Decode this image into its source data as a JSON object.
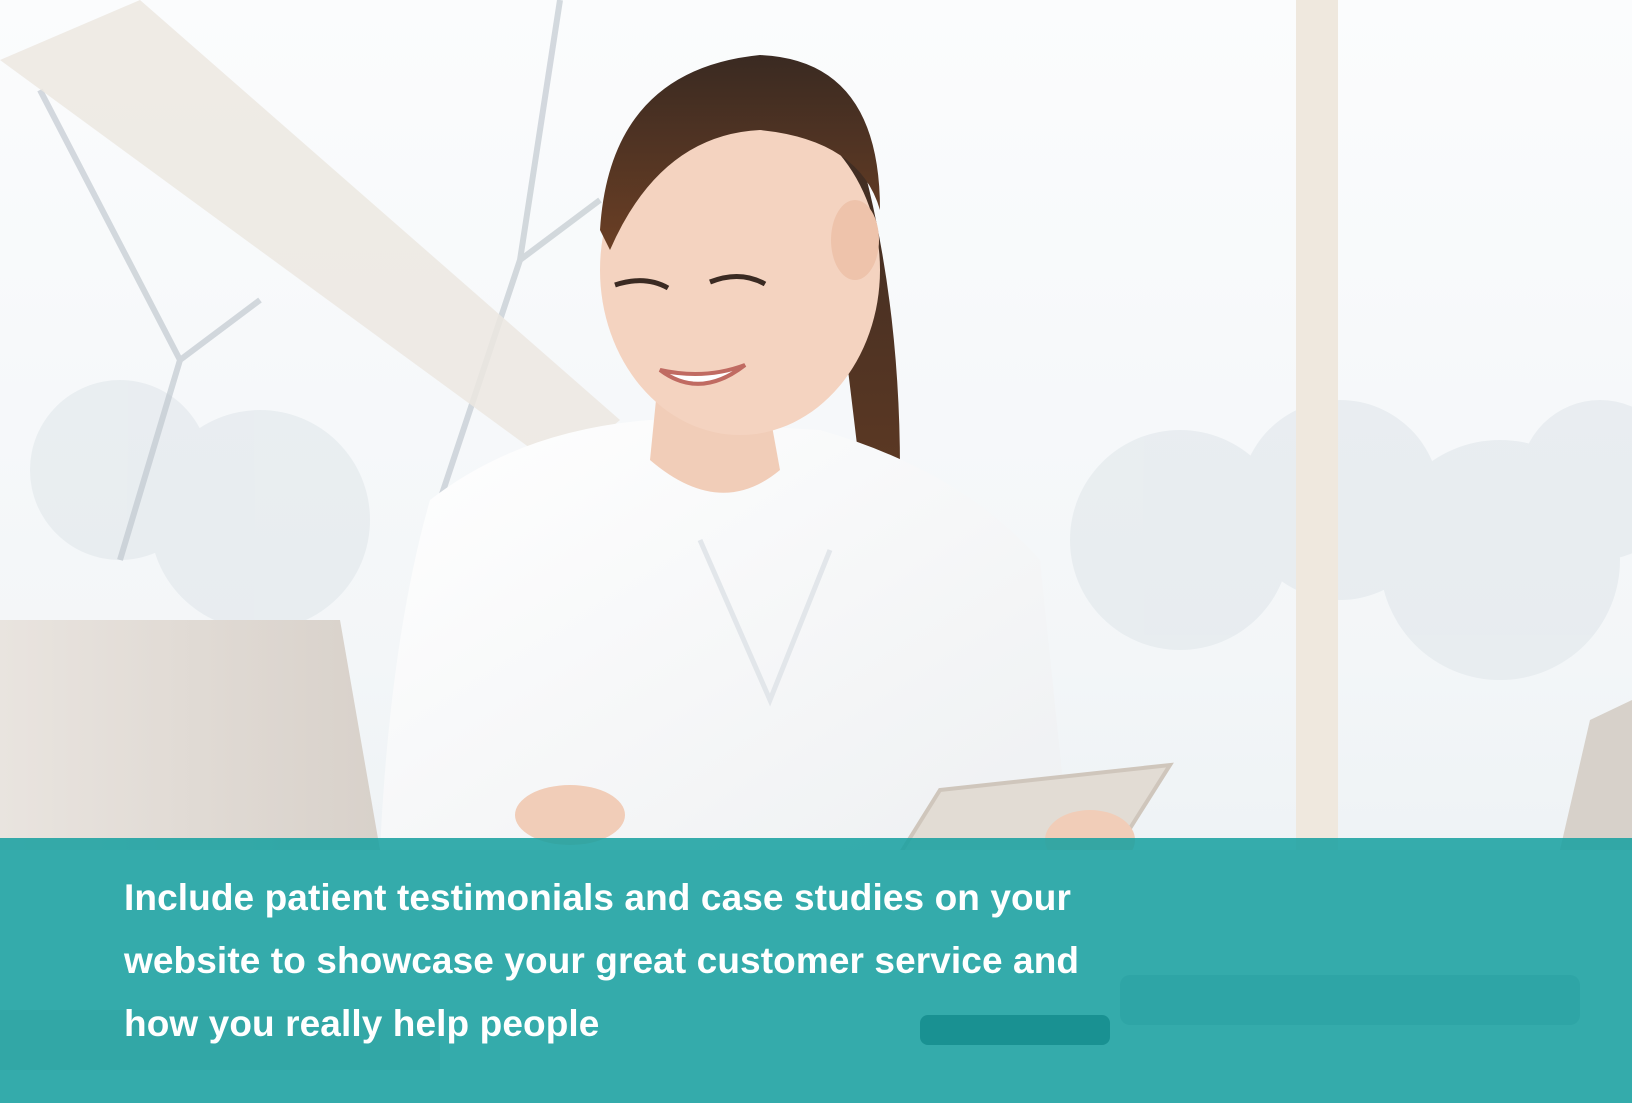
{
  "caption": {
    "text": "Include patient testimonials and case studies on your website to showcase your great customer service and how you really help people"
  },
  "colors": {
    "band": "#16a0a0",
    "caption_text": "#ffffff"
  }
}
